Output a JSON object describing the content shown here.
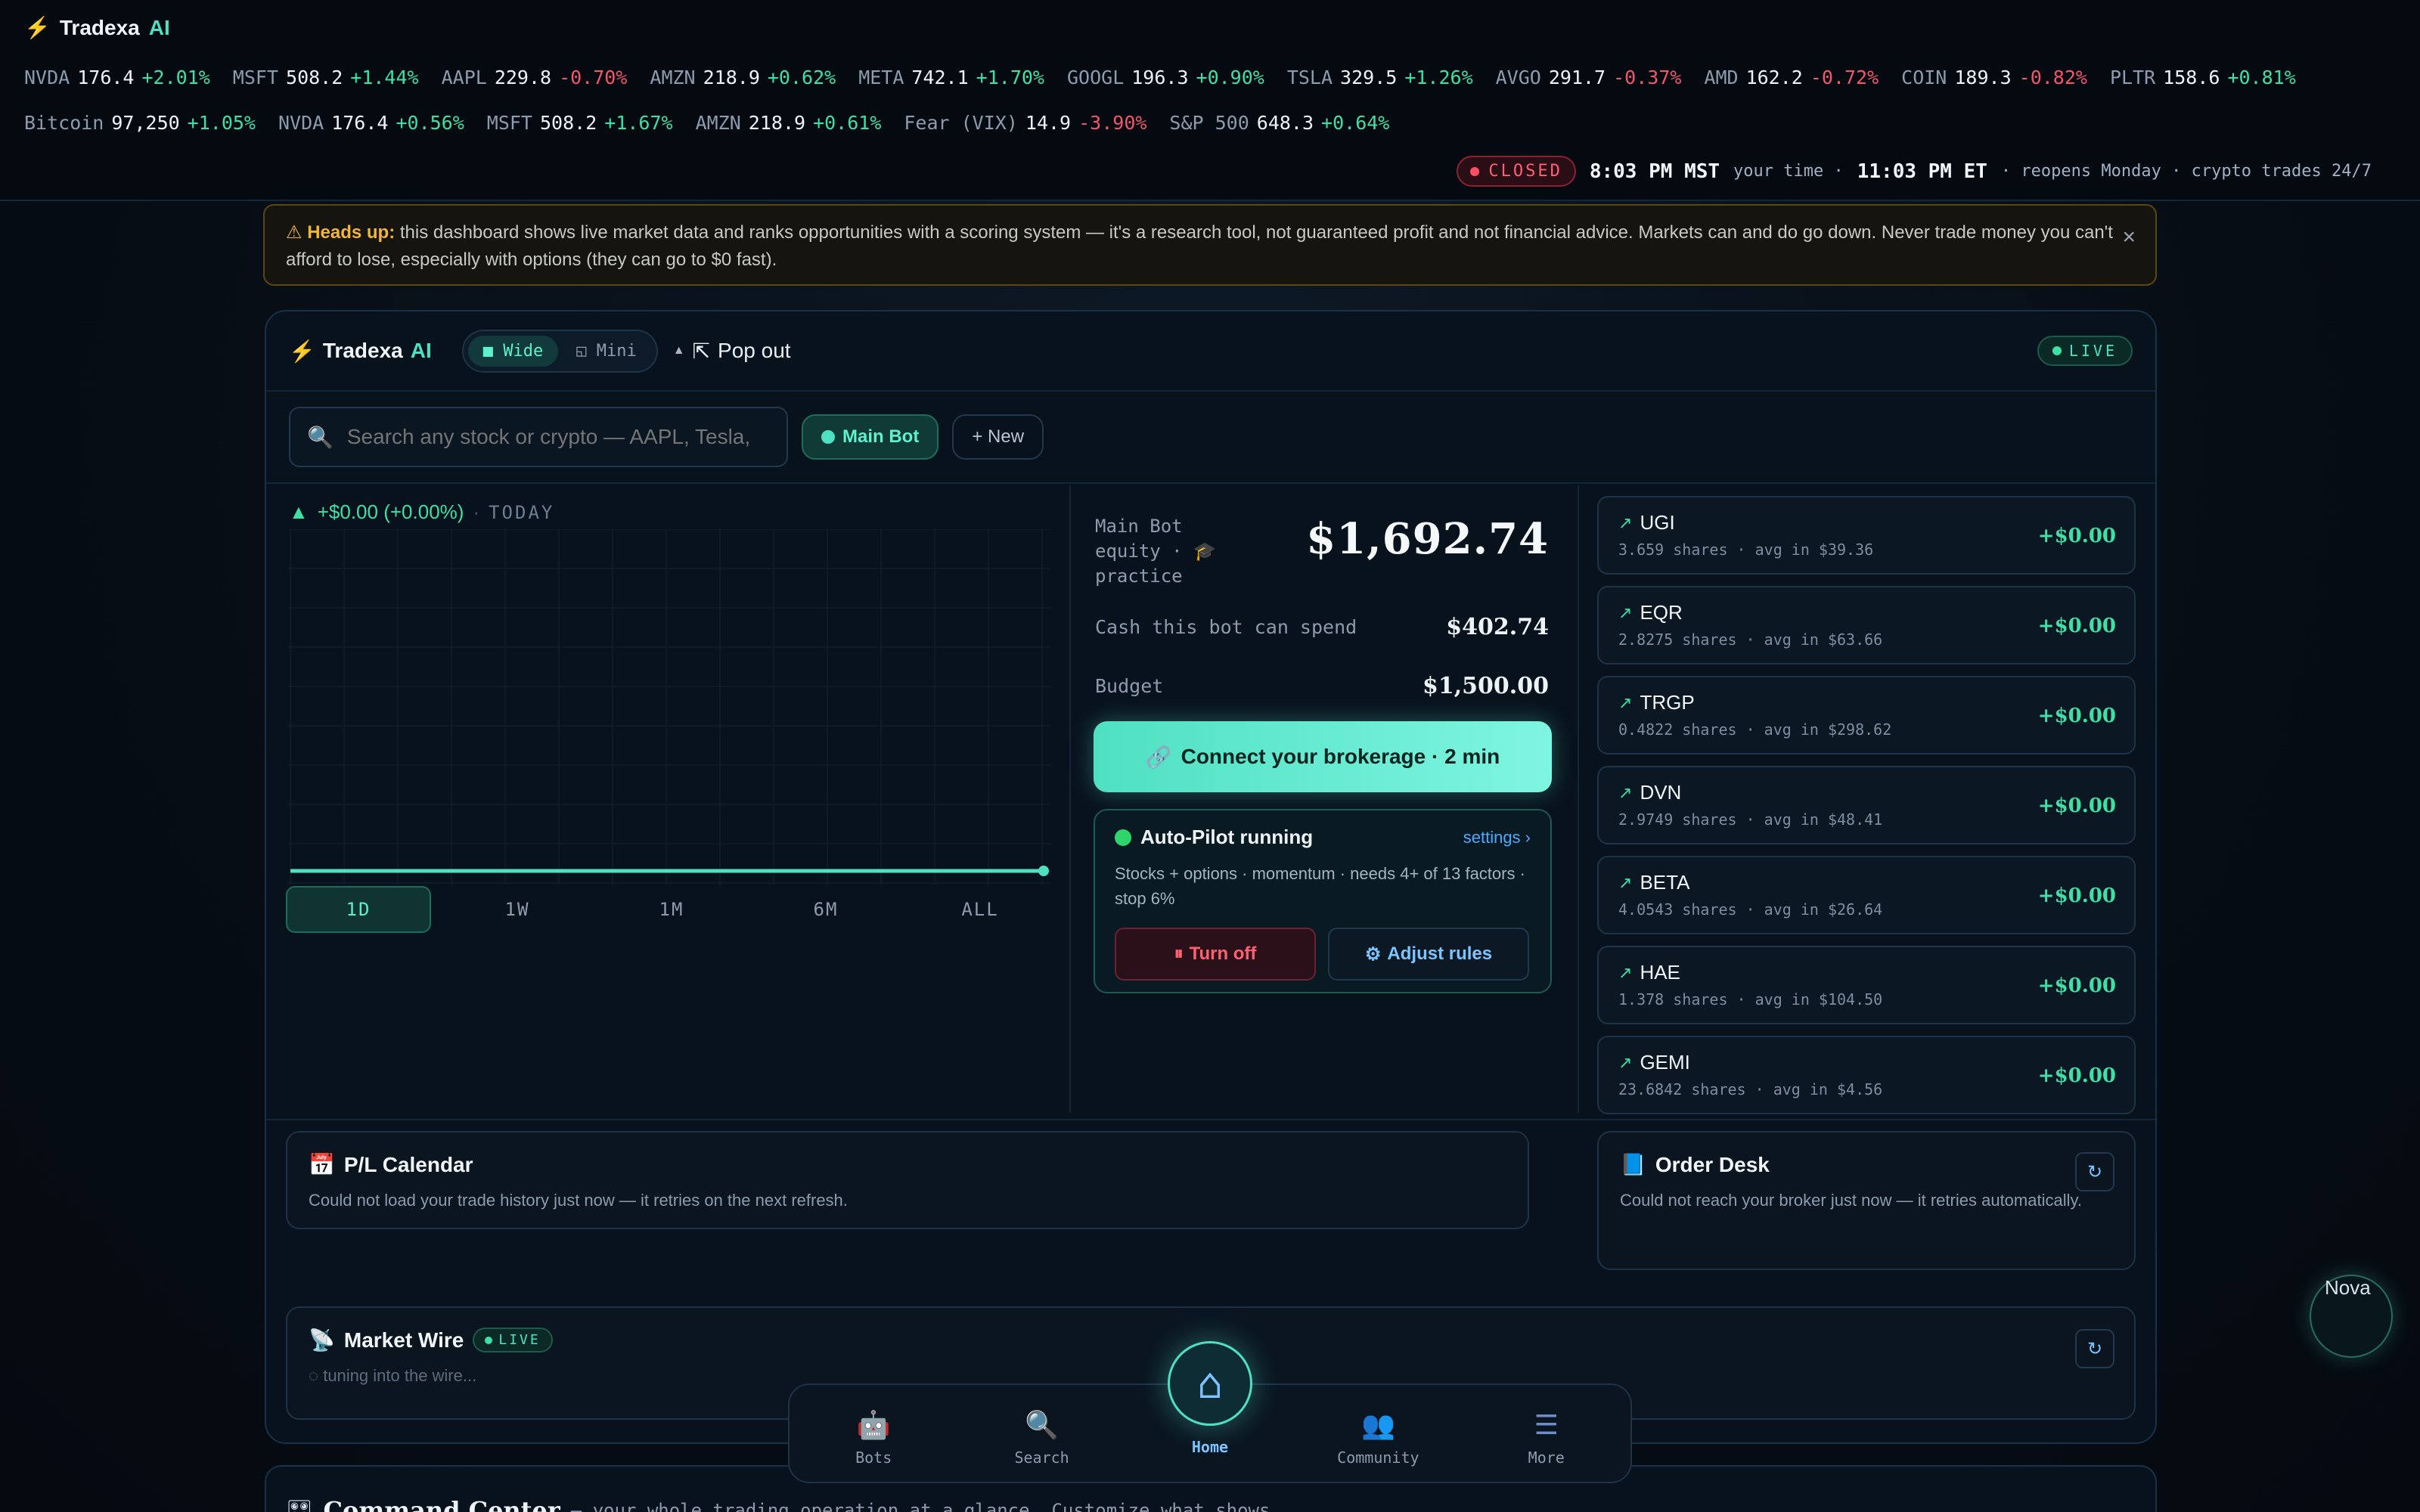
{
  "app": {
    "brand": "Tradexa",
    "brand_ai": "AI"
  },
  "ticker_row1": [
    {
      "sym": "NVDA",
      "px": "176.4",
      "chg": "+2.01%",
      "dir": "up"
    },
    {
      "sym": "MSFT",
      "px": "508.2",
      "chg": "+1.44%",
      "dir": "up"
    },
    {
      "sym": "AAPL",
      "px": "229.8",
      "chg": "-0.70%",
      "dir": "down"
    },
    {
      "sym": "AMZN",
      "px": "218.9",
      "chg": "+0.62%",
      "dir": "up"
    },
    {
      "sym": "META",
      "px": "742.1",
      "chg": "+1.70%",
      "dir": "up"
    },
    {
      "sym": "GOOGL",
      "px": "196.3",
      "chg": "+0.90%",
      "dir": "up"
    },
    {
      "sym": "TSLA",
      "px": "329.5",
      "chg": "+1.26%",
      "dir": "up"
    },
    {
      "sym": "AVGO",
      "px": "291.7",
      "chg": "-0.37%",
      "dir": "down"
    },
    {
      "sym": "AMD",
      "px": "162.2",
      "chg": "-0.72%",
      "dir": "down"
    },
    {
      "sym": "COIN",
      "px": "189.3",
      "chg": "-0.82%",
      "dir": "down"
    },
    {
      "sym": "PLTR",
      "px": "158.6",
      "chg": "+0.81%",
      "dir": "up"
    }
  ],
  "ticker_row2": [
    {
      "sym": "Bitcoin",
      "px": "97,250",
      "chg": "+1.05%",
      "dir": "up"
    },
    {
      "sym": "NVDA",
      "px": "176.4",
      "chg": "+0.56%",
      "dir": "up"
    },
    {
      "sym": "MSFT",
      "px": "508.2",
      "chg": "+1.67%",
      "dir": "up"
    },
    {
      "sym": "AMZN",
      "px": "218.9",
      "chg": "+0.61%",
      "dir": "up"
    },
    {
      "sym": "Fear (VIX)",
      "px": "14.9",
      "chg": "-3.90%",
      "dir": "down"
    },
    {
      "sym": "S&P 500",
      "px": "648.3",
      "chg": "+0.64%",
      "dir": "up"
    }
  ],
  "market_status": {
    "badge": "CLOSED",
    "local_time": "8:03 PM MST",
    "local_suffix": "your time ·",
    "et_time": "11:03 PM ET",
    "tail": "· reopens Monday · crypto trades 24/7"
  },
  "warning": {
    "title": "Heads up:",
    "text": "this dashboard shows live market data and ranks opportunities with a scoring system — it's a research tool, not guaranteed profit and not financial advice. Markets can and do go down. Never trade money you can't afford to lose, especially with options (they can go to $0 fast).",
    "close": "×"
  },
  "panel": {
    "view_wide": "Wide",
    "view_mini": "Mini",
    "popout": "Pop out",
    "live": "LIVE",
    "search_placeholder": "Search any stock or crypto — AAPL, Tesla,",
    "bot_chip": "Main Bot",
    "new_chip": "+ New"
  },
  "chart": {
    "change": "+$0.00 (+0.00%)",
    "period_label": "TODAY",
    "ranges": [
      "1D",
      "1W",
      "1M",
      "6M",
      "ALL"
    ],
    "selected_range": "1D"
  },
  "equity": {
    "label_l1": "Main Bot",
    "label_l2": "equity ·",
    "label_l3": "practice",
    "value": "$1,692.74",
    "cash_label": "Cash this bot can spend",
    "cash_value": "$402.74",
    "budget_label": "Budget",
    "budget_value": "$1,500.00",
    "connect": "Connect your brokerage · 2 min"
  },
  "autopilot": {
    "title": "Auto-Pilot running",
    "settings": "settings ›",
    "desc": "Stocks + options · momentum · needs 4+ of 13 factors · stop 6%",
    "turn_off": "Turn off",
    "adjust": "Adjust rules"
  },
  "positions": [
    {
      "sym": "UGI",
      "sub": "3.659 shares · avg in $39.36",
      "pl": "+$0.00"
    },
    {
      "sym": "EQR",
      "sub": "2.8275 shares · avg in $63.66",
      "pl": "+$0.00"
    },
    {
      "sym": "TRGP",
      "sub": "0.4822 shares · avg in $298.62",
      "pl": "+$0.00"
    },
    {
      "sym": "DVN",
      "sub": "2.9749 shares · avg in $48.41",
      "pl": "+$0.00"
    },
    {
      "sym": "BETA",
      "sub": "4.0543 shares · avg in $26.64",
      "pl": "+$0.00"
    },
    {
      "sym": "HAE",
      "sub": "1.378 shares · avg in $104.50",
      "pl": "+$0.00"
    },
    {
      "sym": "GEMI",
      "sub": "23.6842 shares · avg in $4.56",
      "pl": "+$0.00"
    }
  ],
  "pl_calendar": {
    "title": "P/L Calendar",
    "msg": "Could not load your trade history just now — it retries on the next refresh."
  },
  "order_desk": {
    "title": "Order Desk",
    "msg": "Could not reach your broker just now — it retries automatically."
  },
  "market_wire": {
    "title": "Market Wire",
    "live": "LIVE",
    "msg": "tuning into the wire..."
  },
  "nav": [
    {
      "label": "Bots",
      "icon": "robot-icon"
    },
    {
      "label": "Search",
      "icon": "search-icon"
    },
    {
      "label": "Home",
      "icon": "home-icon"
    },
    {
      "label": "Community",
      "icon": "community-icon"
    },
    {
      "label": "More",
      "icon": "menu-icon"
    }
  ],
  "command_center": {
    "title": "Command Center",
    "sub": "— your whole trading operation at a glance. Customize what shows."
  },
  "nova": {
    "label": "Nova"
  },
  "colors": {
    "accent": "#4fe0c2",
    "up": "#3ee0a5",
    "down": "#f2556c",
    "warn": "#f2b53c"
  }
}
